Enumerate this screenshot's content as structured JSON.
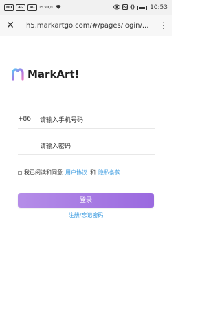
{
  "status_bar": {
    "left_badges": [
      "HD",
      "4G",
      "4G"
    ],
    "network_speed": "15.9 K/s",
    "time": "10:53",
    "battery_color": "#333333"
  },
  "browser": {
    "close_icon": "close-icon",
    "url": "h5.markartgo.com/#/pages/login/...",
    "more_icon": "more-vertical-icon"
  },
  "logo": {
    "mark_icon": "markart-logo-icon",
    "text": "MarkArt!"
  },
  "form": {
    "phone_prefix": "+86",
    "phone_placeholder": "请输入手机号码",
    "password_placeholder": "请输入密码"
  },
  "agreement": {
    "prefix": "我已阅读和同意",
    "user_agreement": "用户协议",
    "and": "和",
    "privacy_policy": "隐私条款",
    "link_color": "#3b9be0"
  },
  "login_button": {
    "label": "登录",
    "gradient_start": "#b58de8",
    "gradient_end": "#9a69df"
  },
  "register_link": {
    "label": "注册/忘记密码"
  }
}
